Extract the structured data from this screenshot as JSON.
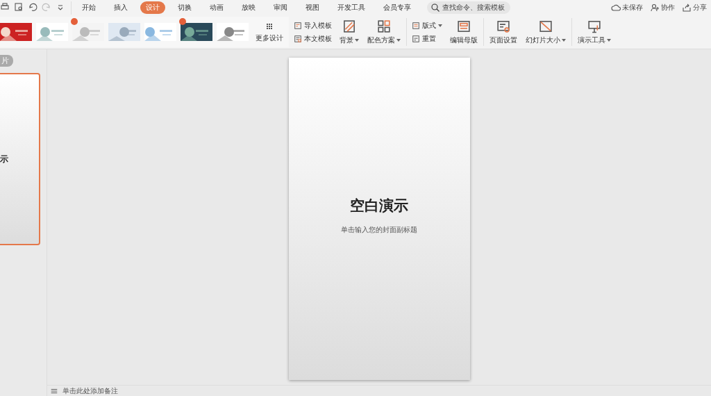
{
  "tabs": [
    {
      "label": "开始",
      "selected": false
    },
    {
      "label": "插入",
      "selected": false
    },
    {
      "label": "设计",
      "selected": true
    },
    {
      "label": "切换",
      "selected": false
    },
    {
      "label": "动画",
      "selected": false
    },
    {
      "label": "放映",
      "selected": false
    },
    {
      "label": "审阅",
      "selected": false
    },
    {
      "label": "视图",
      "selected": false
    },
    {
      "label": "开发工具",
      "selected": false
    },
    {
      "label": "会员专享",
      "selected": false
    }
  ],
  "search": {
    "placeholder": "查找命令、搜索模板"
  },
  "top_actions": [
    {
      "kind": "cloud",
      "label": "未保存"
    },
    {
      "kind": "user",
      "label": "协作"
    },
    {
      "kind": "share",
      "label": "分享"
    }
  ],
  "templates": [
    {
      "kind": "picture",
      "hot": false
    },
    {
      "kind": "picture",
      "hot": false
    },
    {
      "kind": "picture",
      "hot": true
    },
    {
      "kind": "picture",
      "hot": false
    },
    {
      "kind": "picture",
      "hot": false
    },
    {
      "kind": "picture",
      "hot": true
    },
    {
      "kind": "picture",
      "hot": false
    }
  ],
  "more_designs": {
    "label": "更多设计"
  },
  "ribbon": [
    {
      "kind": "stack",
      "items": [
        {
          "label": "导入模板",
          "dropdown": false
        },
        {
          "label": "本文模板",
          "dropdown": false
        }
      ]
    },
    {
      "kind": "big",
      "label": "背景",
      "dropdown": true
    },
    {
      "kind": "big",
      "label": "配色方案",
      "dropdown": true
    },
    {
      "kind": "stack",
      "items": [
        {
          "label": "版式",
          "dropdown": true
        },
        {
          "label": "重置",
          "dropdown": false
        }
      ]
    },
    {
      "kind": "big",
      "label": "编辑母版",
      "dropdown": false
    },
    {
      "kind": "big",
      "label": "页面设置",
      "dropdown": false
    },
    {
      "kind": "big",
      "label": "幻灯片大小",
      "dropdown": true
    },
    {
      "kind": "big",
      "label": "演示工具",
      "dropdown": true
    }
  ],
  "panel": {
    "badge": "片",
    "thumbnail": {
      "title": "示",
      "selected": true
    }
  },
  "slide": {
    "title": "空白演示",
    "subtitle": "单击输入您的封面副标题"
  },
  "notes": {
    "placeholder": "单击此处添加备注"
  }
}
